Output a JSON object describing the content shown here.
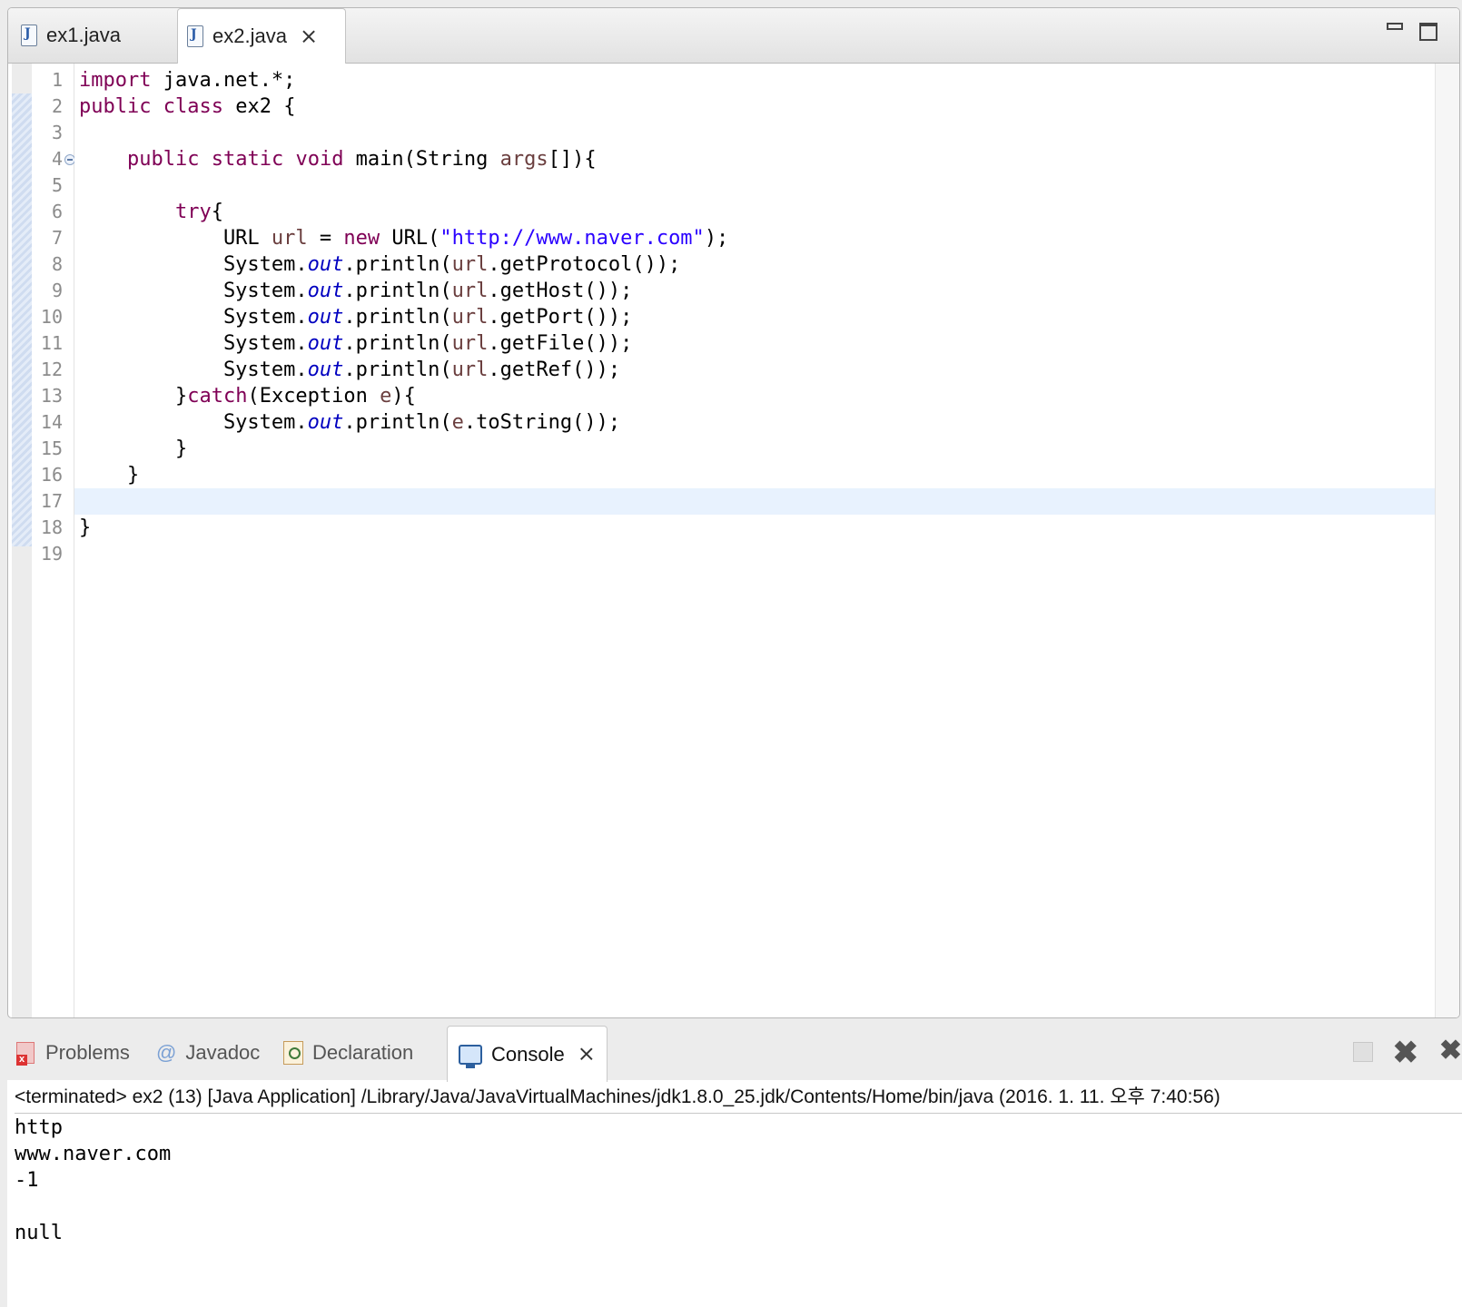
{
  "editor": {
    "tabs": [
      {
        "label": "ex1.java",
        "icon": "java-file-icon",
        "active": false
      },
      {
        "label": "ex2.java",
        "icon": "java-file-icon",
        "active": true,
        "close": "⨯"
      }
    ],
    "line_numbers": [
      "1",
      "2",
      "3",
      "4",
      "5",
      "6",
      "7",
      "8",
      "9",
      "10",
      "11",
      "12",
      "13",
      "14",
      "15",
      "16",
      "17",
      "18",
      "19"
    ],
    "current_line": 17,
    "code": [
      "import java.net.*;",
      "public class ex2 {",
      "",
      "    public static void main(String args[]){",
      "",
      "        try{",
      "            URL url = new URL(\"http://www.naver.com\");",
      "            System.out.println(url.getProtocol());",
      "            System.out.println(url.getHost());",
      "            System.out.println(url.getPort());",
      "            System.out.println(url.getFile());",
      "            System.out.println(url.getRef());",
      "        }catch(Exception e){",
      "            System.out.println(e.toString());",
      "        }",
      "    }",
      "",
      "}",
      ""
    ]
  },
  "console_view": {
    "tabs": [
      {
        "label": "Problems",
        "icon": "problems-icon"
      },
      {
        "label": "Javadoc",
        "icon": "javadoc-icon"
      },
      {
        "label": "Declaration",
        "icon": "declaration-icon"
      },
      {
        "label": "Console",
        "icon": "console-icon",
        "active": true,
        "close": "⨯"
      }
    ],
    "header": "<terminated> ex2 (13) [Java Application] /Library/Java/JavaVirtualMachines/jdk1.8.0_25.jdk/Contents/Home/bin/java (2016. 1. 11. 오후 7:40:56)",
    "output": [
      "http",
      "www.naver.com",
      "-1",
      "",
      "null"
    ]
  },
  "colors": {
    "keyword": "#7f0055",
    "string": "#2a00ff",
    "static_field": "#0000c0",
    "local_variable": "#6a3e3e",
    "current_line_highlight": "#e8f2fe"
  }
}
